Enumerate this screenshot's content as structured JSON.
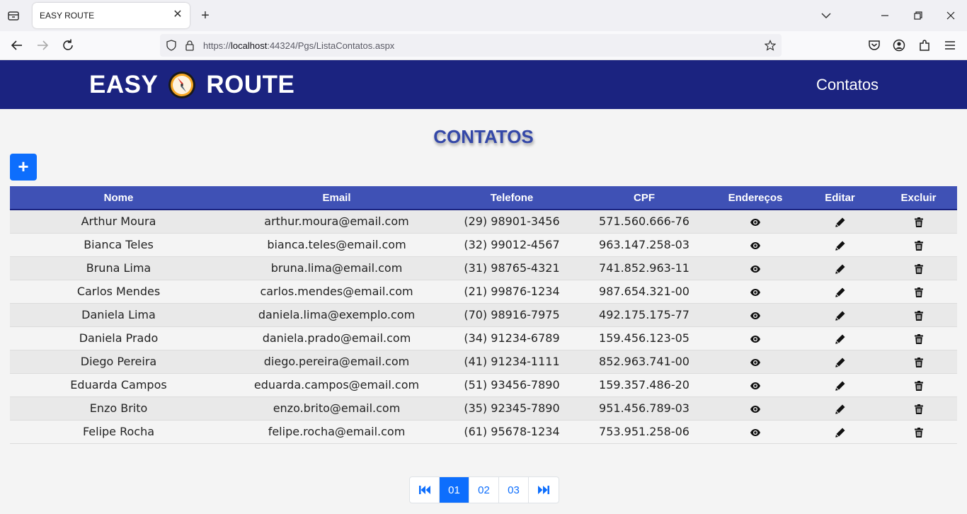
{
  "browser": {
    "tab_title": "EASY ROUTE",
    "tab_close": "✕",
    "new_tab": "+",
    "url_prefix": "https://",
    "url_host": "localhost",
    "url_rest": ":44324/Pgs/ListaContatos.aspx"
  },
  "header": {
    "brand_left": "EASY",
    "brand_right": "ROUTE",
    "nav_link": "Contatos"
  },
  "page": {
    "title": "CONTATOS",
    "add_button": "+"
  },
  "table": {
    "columns": [
      "Nome",
      "Email",
      "Telefone",
      "CPF",
      "Endereços",
      "Editar",
      "Excluir"
    ],
    "rows": [
      [
        "Arthur Moura",
        "arthur.moura@email.com",
        "(29) 98901-3456",
        "571.560.666-76"
      ],
      [
        "Bianca Teles",
        "bianca.teles@email.com",
        "(32) 99012-4567",
        "963.147.258-03"
      ],
      [
        "Bruna Lima",
        "bruna.lima@email.com",
        "(31) 98765-4321",
        "741.852.963-11"
      ],
      [
        "Carlos Mendes",
        "carlos.mendes@email.com",
        "(21) 99876-1234",
        "987.654.321-00"
      ],
      [
        "Daniela Lima",
        "daniela.lima@exemplo.com",
        "(70) 98916-7975",
        "492.175.175-77"
      ],
      [
        "Daniela Prado",
        "daniela.prado@email.com",
        "(34) 91234-6789",
        "159.456.123-05"
      ],
      [
        "Diego Pereira",
        "diego.pereira@email.com",
        "(41) 91234-1111",
        "852.963.741-00"
      ],
      [
        "Eduarda Campos",
        "eduarda.campos@email.com",
        "(51) 93456-7890",
        "159.357.486-20"
      ],
      [
        "Enzo Brito",
        "enzo.brito@email.com",
        "(35) 92345-7890",
        "951.456.789-03"
      ],
      [
        "Felipe Rocha",
        "felipe.rocha@email.com",
        "(61) 95678-1234",
        "753.951.258-06"
      ]
    ],
    "row_icons": [
      "eye-icon",
      "pencil-icon",
      "trash-icon"
    ]
  },
  "pager": {
    "pages": [
      "01",
      "02",
      "03"
    ],
    "current": "01",
    "icons": [
      "first-page-icon",
      "last-page-icon"
    ]
  },
  "colors": {
    "header_bg": "#1b2380",
    "table_header_bg": "#3f51b5",
    "accent": "#0d6efd",
    "title": "#3448a8"
  }
}
